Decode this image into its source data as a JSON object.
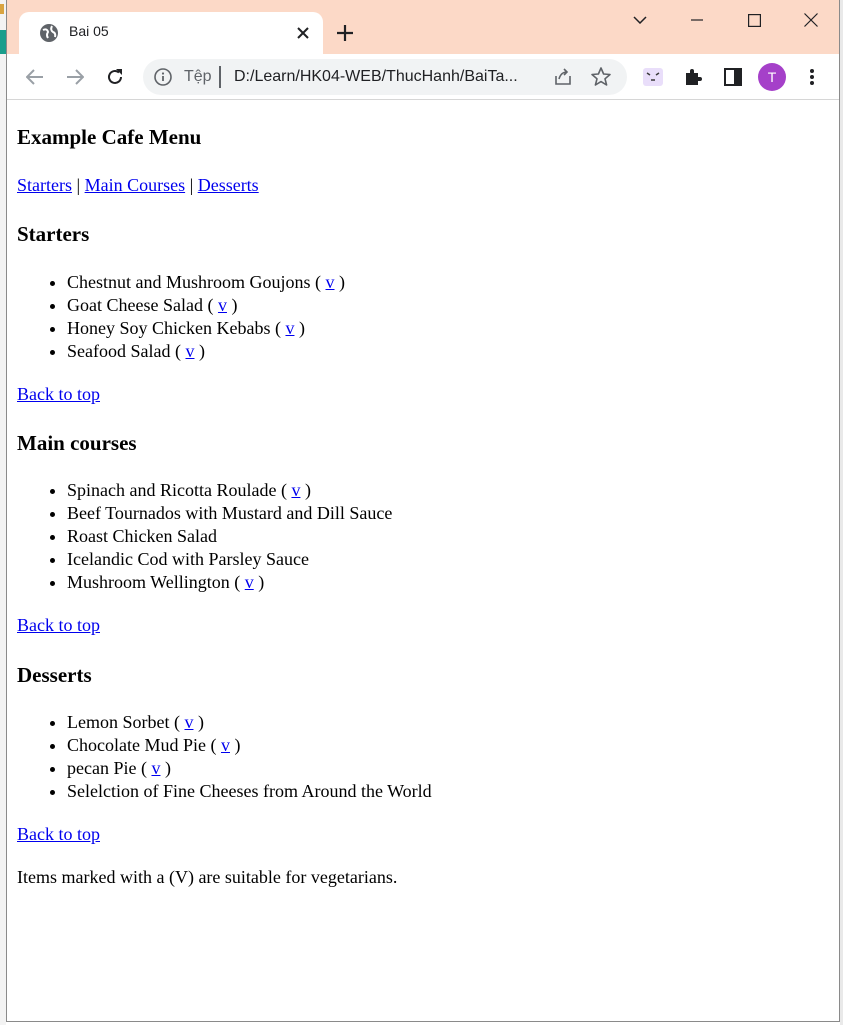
{
  "browser": {
    "tab_title": "Bai 05",
    "url_scheme": "Tệp",
    "url": "D:/Learn/HK04-WEB/ThucHanh/BaiTa...",
    "profile_initial": "T"
  },
  "page": {
    "title": "Example Cafe Menu",
    "nav": {
      "starters": "Starters",
      "sep": "|",
      "main": "Main Courses",
      "desserts": "Desserts"
    },
    "back_to_top": "Back to top",
    "veg_marker": "v",
    "sections": {
      "starters": {
        "heading": "Starters",
        "items": [
          {
            "name": "Chestnut and Mushroom Goujons",
            "veg": true
          },
          {
            "name": "Goat Cheese Salad",
            "veg": true
          },
          {
            "name": "Honey Soy Chicken Kebabs",
            "veg": true
          },
          {
            "name": "Seafood Salad",
            "veg": true
          }
        ]
      },
      "main": {
        "heading": "Main courses",
        "items": [
          {
            "name": "Spinach and Ricotta Roulade",
            "veg": true
          },
          {
            "name": "Beef Tournados with Mustard and Dill Sauce",
            "veg": false
          },
          {
            "name": "Roast Chicken Salad",
            "veg": false
          },
          {
            "name": "Icelandic Cod with Parsley Sauce",
            "veg": false
          },
          {
            "name": "Mushroom Wellington",
            "veg": true
          }
        ]
      },
      "desserts": {
        "heading": "Desserts",
        "items": [
          {
            "name": "Lemon Sorbet",
            "veg": true
          },
          {
            "name": "Chocolate Mud Pie",
            "veg": true
          },
          {
            "name": "pecan Pie",
            "veg": true
          },
          {
            "name": "Selelction of Fine Cheeses from Around the World",
            "veg": false
          }
        ]
      }
    },
    "footnote": "Items marked with a (V) are suitable for vegetarians."
  },
  "colors": {
    "tabstrip": "#fcd9c7",
    "link": "#0000ee",
    "avatar": "#a540c9"
  }
}
